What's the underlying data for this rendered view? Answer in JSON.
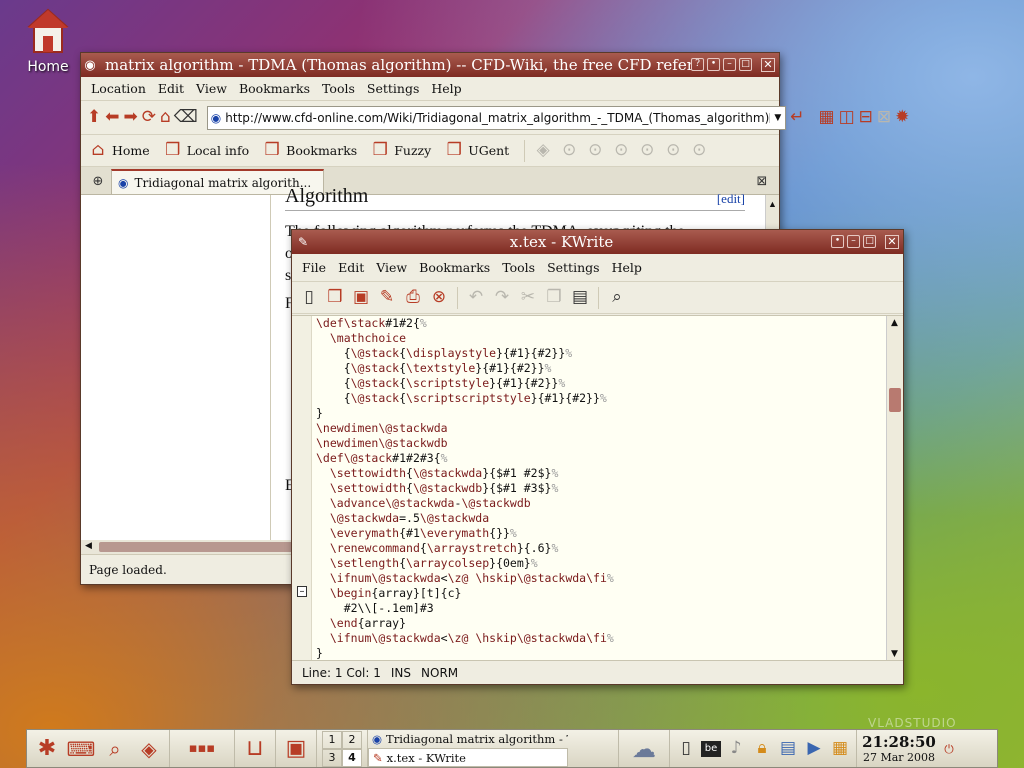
{
  "desktop": {
    "home_label": "Home",
    "watermark": "VLADSTUDIO"
  },
  "konqueror": {
    "title": "matrix algorithm - TDMA (Thomas algorithm) -- CFD-Wiki, the free CFD reference - Konqueror",
    "menu": [
      "Location",
      "Edit",
      "View",
      "Bookmarks",
      "Tools",
      "Settings",
      "Help"
    ],
    "url": "http://www.cfd-online.com/Wiki/Tridiagonal_matrix_algorithm_-_TDMA_(Thomas_algorithm)",
    "bookmarks": [
      "Home",
      "Local info",
      "Bookmarks",
      "Fuzzy",
      "UGent"
    ],
    "tab_title": "Tridiagonal matrix algorith...",
    "page_heading": "Algorithm",
    "page_edit": "[edit]",
    "page_text_lines": [
      "The following algorithm performs the TDMA, overwriting the",
      "o",
      "s",
      "F",
      "",
      "",
      "",
      "",
      "",
      "",
      "",
      "E"
    ],
    "status": "Page loaded."
  },
  "kwrite": {
    "title": "x.tex - KWrite",
    "menu": [
      "File",
      "Edit",
      "View",
      "Bookmarks",
      "Tools",
      "Settings",
      "Help"
    ],
    "code_lines": [
      "\\def\\stack#1#2{%",
      "  \\mathchoice",
      "    {\\@stack{\\displaystyle}{#1}{#2}}%",
      "    {\\@stack{\\textstyle}{#1}{#2}}%",
      "    {\\@stack{\\scriptstyle}{#1}{#2}}%",
      "    {\\@stack{\\scriptscriptstyle}{#1}{#2}}%",
      "}",
      "\\newdimen\\@stackwda",
      "\\newdimen\\@stackwdb",
      "\\def\\@stack#1#2#3{%",
      "  \\settowidth{\\@stackwda}{$#1 #2$}%",
      "  \\settowidth{\\@stackwdb}{$#1 #3$}%",
      "  \\advance\\@stackwda-\\@stackwdb",
      "  \\@stackwda=.5\\@stackwda",
      "  \\everymath{#1\\everymath{}}%",
      "  \\renewcommand{\\arraystretch}{.6}%",
      "  \\setlength{\\arraycolsep}{0em}%",
      "  \\ifnum\\@stackwda<\\z@ \\hskip\\@stackwda\\fi%",
      "  \\begin{array}[t]{c}",
      "    #2\\\\[-.1em]#3",
      "  \\end{array}",
      "  \\ifnum\\@stackwda<\\z@ \\hskip\\@stackwda\\fi%",
      "}"
    ],
    "status": {
      "position": "Line: 1 Col: 1",
      "mode1": "INS",
      "mode2": "NORM"
    }
  },
  "taskbar": {
    "desktops": [
      "1",
      "2",
      "3",
      "4"
    ],
    "tasks": [
      "Tridiagonal matrix algorithm - TDMA",
      "x.tex - KWrite"
    ],
    "time": "21:28:50",
    "date": "27 Mar 2008"
  },
  "colors": {
    "titlebar": "#8e3a30",
    "accent": "#b73c25",
    "macro": "#7a1a1a"
  }
}
